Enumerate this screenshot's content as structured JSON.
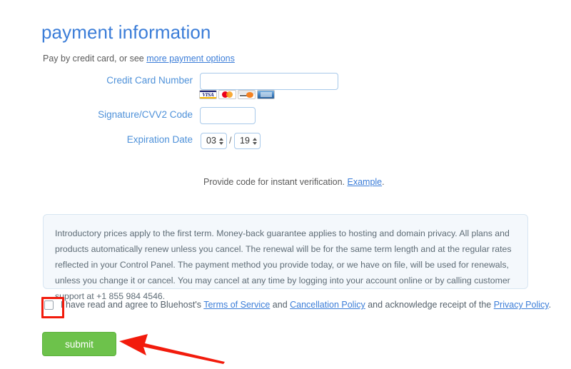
{
  "header": {
    "title": "payment information",
    "subtitle_prefix": "Pay by credit card, or see ",
    "subtitle_link": "more payment options"
  },
  "form": {
    "credit_card": {
      "label": "Credit Card Number",
      "value": "",
      "placeholder": ""
    },
    "cvv": {
      "label": "Signature/CVV2 Code",
      "value": "",
      "placeholder": ""
    },
    "expiration": {
      "label": "Expiration Date",
      "separator": "/",
      "month": "03",
      "year": "19"
    },
    "accepted_cards": [
      "visa-card-icon",
      "mastercard-card-icon",
      "discover-card-icon",
      "amex-card-icon"
    ],
    "visa_text": "VISA"
  },
  "verification": {
    "text": "Provide code for instant verification. ",
    "link": "Example",
    "period": "."
  },
  "disclaimer": {
    "text": "Introductory prices apply to the first term. Money-back guarantee applies to hosting and domain privacy. All plans and products automatically renew unless you cancel. The renewal will be for the same term length and at the regular rates reflected in your Control Panel. The payment method you provide today, or we have on file, will be used for renewals, unless you change it or cancel. You may cancel at any time by logging into your account online or by calling customer support at +1 855 984 4546."
  },
  "agreement": {
    "checked": false,
    "part1": "I have read and agree to Bluehost's ",
    "link1": "Terms of Service",
    "part2": " and ",
    "link2": "Cancellation Policy",
    "part3": " and acknowledge receipt of the ",
    "link3": "Privacy Policy",
    "part4": "."
  },
  "actions": {
    "submit_label": "submit"
  },
  "annotations": {
    "highlight_color": "#f21b0c",
    "arrow_color": "#f21b0c",
    "arrow_target": "submit-button"
  },
  "colors": {
    "heading_blue": "#3b7dd8",
    "label_blue": "#4e91d9",
    "link_blue": "#3b7dd8",
    "submit_green": "#6dc24b",
    "disclaimer_bg": "#f4f8fc",
    "input_border": "#a8c9ea"
  }
}
